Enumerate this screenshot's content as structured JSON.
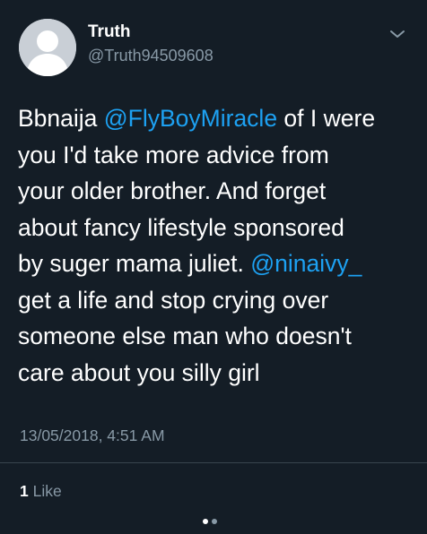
{
  "author": {
    "name": "Truth",
    "handle": "@Truth94509608"
  },
  "tweet": {
    "lines": [
      [
        {
          "text": "Bbnaija "
        },
        {
          "text": "@FlyBoyMiracle",
          "mention": true
        },
        {
          "text": " of I were"
        }
      ],
      [
        {
          "text": "you I'd take more advice from"
        }
      ],
      [
        {
          "text": "your older brother. And forget"
        }
      ],
      [
        {
          "text": "about fancy lifestyle sponsored"
        }
      ],
      [
        {
          "text": "by suger mama juliet. "
        },
        {
          "text": "@ninaivy_",
          "mention": true
        }
      ],
      [
        {
          "text": "get a life and stop crying over"
        }
      ],
      [
        {
          "text": "someone else man who doesn't"
        }
      ],
      [
        {
          "text": "care about you silly girl"
        }
      ]
    ],
    "timestamp": "13/05/2018, 4:51 AM"
  },
  "likes": {
    "count": "1",
    "label": "Like"
  },
  "pagination": {
    "total": 2,
    "active": 0
  },
  "icons": {
    "menu": "chevron-down-icon",
    "avatar": "default-avatar-icon"
  },
  "colors": {
    "background": "#141d26",
    "mention": "#1da1f2",
    "secondary_text": "#8899a6"
  }
}
